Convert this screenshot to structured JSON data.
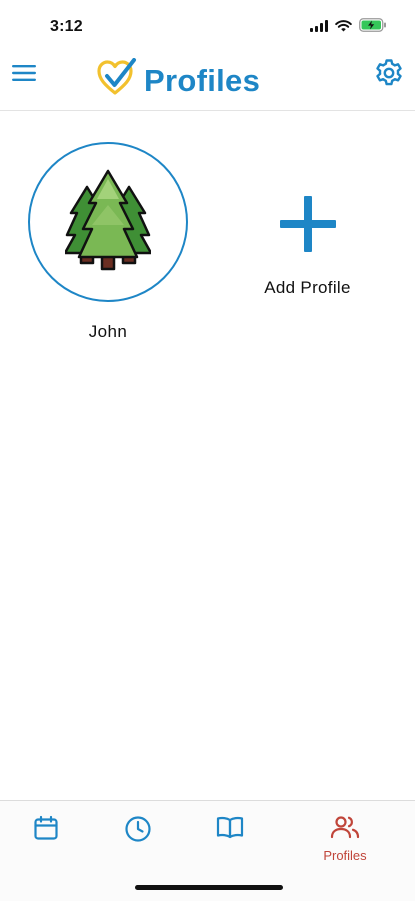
{
  "status_bar": {
    "time": "3:12"
  },
  "header": {
    "title": "Profiles",
    "menu_icon": "hamburger-menu-icon",
    "logo_icon": "heart-check-logo-icon",
    "settings_icon": "gear-icon"
  },
  "profiles": [
    {
      "name": "John",
      "avatar": "pine-trees-avatar"
    }
  ],
  "add_profile": {
    "label": "Add Profile",
    "icon": "plus-icon"
  },
  "tabs": [
    {
      "id": "calendar",
      "icon": "calendar-icon",
      "label": ""
    },
    {
      "id": "history",
      "icon": "clock-icon",
      "label": ""
    },
    {
      "id": "journal",
      "icon": "book-icon",
      "label": ""
    },
    {
      "id": "profiles",
      "icon": "people-icon",
      "label": "Profiles",
      "active": true
    }
  ],
  "colors": {
    "brand_blue": "#1e86c6",
    "active_tab": "#c0453a",
    "logo_yellow": "#f2c12e"
  }
}
